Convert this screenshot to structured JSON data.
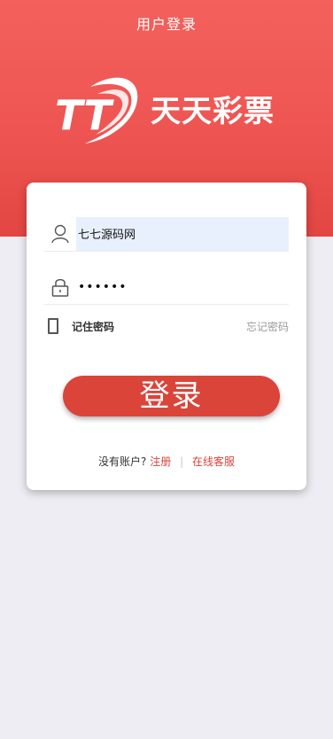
{
  "header": {
    "title": "用户登录"
  },
  "brand": {
    "mark": "TT",
    "name": "天天彩票"
  },
  "form": {
    "username_value": "七七源码网",
    "password_value": "••••••",
    "remember_label": "记住密码",
    "forgot_label": "忘记密码",
    "submit_label": "登录"
  },
  "footer": {
    "prompt": "没有账户?",
    "register_label": "注册",
    "separator": "|",
    "support_label": "在线客服"
  },
  "colors": {
    "header_top": "#f3615c",
    "header_bottom": "#e34642",
    "button": "#db4439",
    "link": "#d9423b",
    "page_bg": "#eeedf3"
  },
  "icons": [
    "user-icon",
    "lock-icon",
    "checkbox-icon"
  ]
}
